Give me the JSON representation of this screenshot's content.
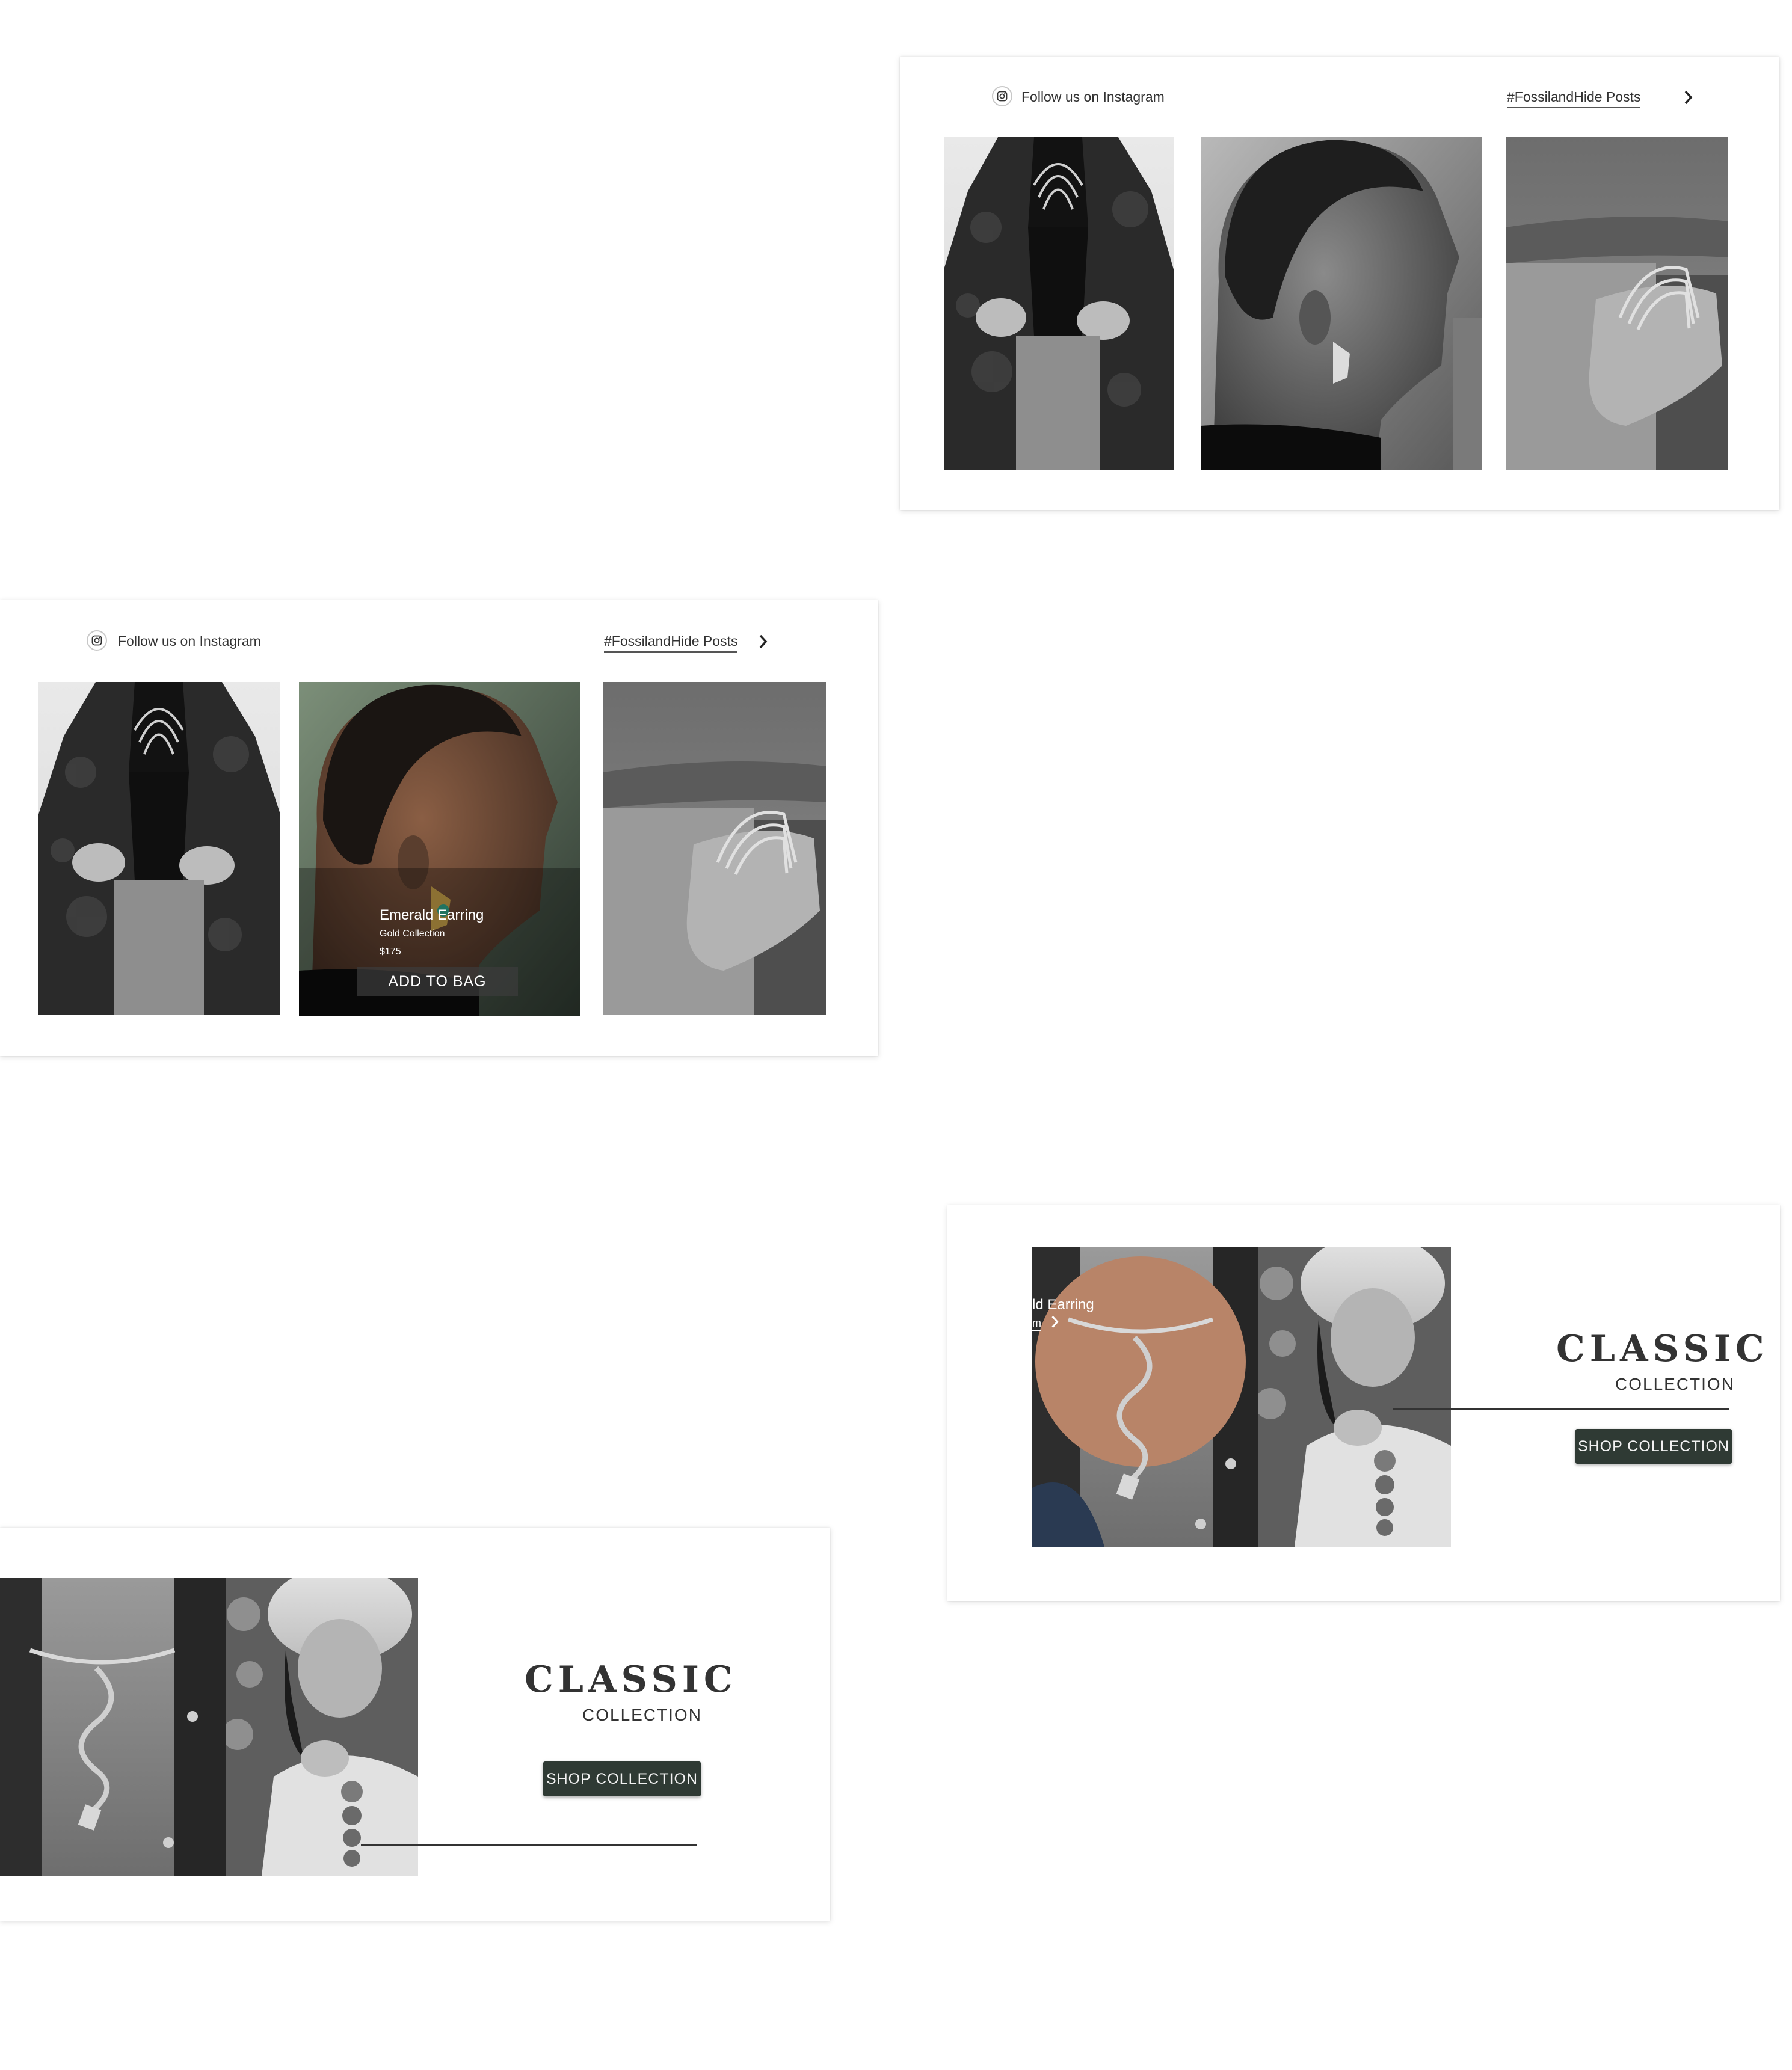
{
  "colors": {
    "button_bg": "#2f3a34",
    "button_text": "#f1f1f1",
    "rule_line": "#333333",
    "card_bg": "#ffffff"
  },
  "instagram_a": {
    "icon": "instagram-icon",
    "follow_label": "Follow us on Instagram",
    "hashtag_link": "#FossilandHide  Posts",
    "next_icon": "chevron-right-icon"
  },
  "instagram_b": {
    "icon": "instagram-icon",
    "follow_label": "Follow us on Instagram",
    "hashtag_link": "#FossilandHide  Posts",
    "next_icon": "chevron-right-icon",
    "hover_product": {
      "name": "Emerald Earring",
      "collection": "Gold Collection",
      "price": "$175",
      "cta": "ADD TO BAG"
    }
  },
  "classic_a": {
    "title": "CLASSIC",
    "subtitle": "COLLECTION",
    "cta": "SHOP COLLECTION",
    "peek_product": {
      "name": "ld Earring",
      "sub": "m",
      "next_icon": "chevron-right-icon"
    }
  },
  "classic_b": {
    "title": "CLASSIC",
    "subtitle": "COLLECTION",
    "cta": "SHOP COLLECTION"
  }
}
